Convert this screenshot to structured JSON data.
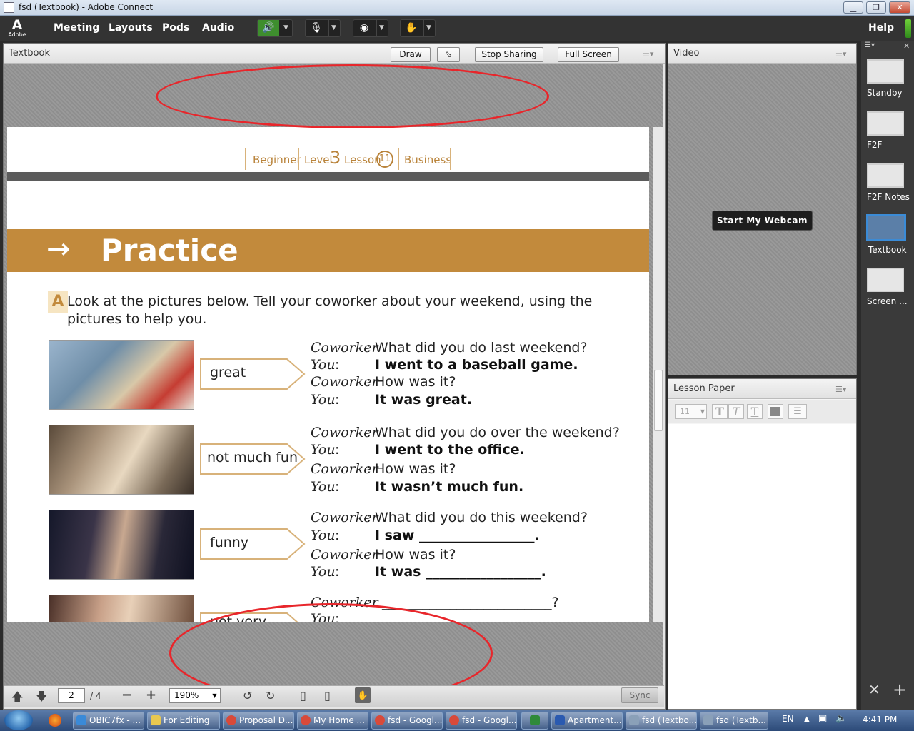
{
  "window": {
    "title": "fsd (Textbook) - Adobe Connect"
  },
  "menubar": {
    "logo": "A",
    "logo_text": "Adobe",
    "items": [
      "Meeting",
      "Layouts",
      "Pods",
      "Audio"
    ],
    "help": "Help"
  },
  "textbook_pod": {
    "title": "Textbook",
    "buttons": {
      "draw": "Draw",
      "stop": "Stop Sharing",
      "full": "Full Screen"
    },
    "doc": {
      "nav": [
        "Beginner",
        "Level",
        "3",
        "Lesson",
        "11",
        "Business"
      ],
      "heading": "Practice",
      "letter": "A",
      "instruction_line1": "Look at the pictures below. Tell your coworker about your weekend, using the",
      "instruction_line2": "pictures to help you.",
      "tags": [
        "great",
        "not much fun",
        "funny",
        "not very"
      ],
      "speaker_coworker": "Coworker",
      "speaker_you": "You",
      "colon": ":",
      "dialogs": [
        {
          "q": "What did you do last weekend?",
          "a": "I went to a baseball game.",
          "q2": "How was it?",
          "a2": "It was great."
        },
        {
          "q": "What did you do over the weekend?",
          "a": "I went to the office.",
          "q2": "How was it?",
          "a2": "It wasn’t much fun."
        },
        {
          "q": "What did you do this weekend?",
          "a": "I saw _________________.",
          "q2": "How was it?",
          "a2": "It was _________________."
        }
      ],
      "q4_blank": "_________________________?"
    },
    "bottom": {
      "page": "2",
      "total": "/ 4",
      "zoom": "190%",
      "sync": "Sync"
    }
  },
  "video_pod": {
    "title": "Video",
    "webcam_button": "Start My Webcam"
  },
  "lesson_pod": {
    "title": "Lesson Paper",
    "font_size": "11"
  },
  "layouts": [
    "Standby",
    "F2F",
    "F2F Notes",
    "Textbook",
    "Screen ..."
  ],
  "taskbar": {
    "items": [
      "OBIC7fx - ...",
      "For Editing",
      "Proposal D...",
      "My Home ...",
      "fsd - Googl...",
      "fsd - Googl...",
      "",
      "Apartment...",
      "fsd (Textbo...",
      "fsd (Textb..."
    ],
    "lang": "EN",
    "time": "4:41 PM"
  },
  "colors": {
    "practice_band": "#c28a3c",
    "nav_text": "#b9833a",
    "annotation": "#e8262b"
  }
}
